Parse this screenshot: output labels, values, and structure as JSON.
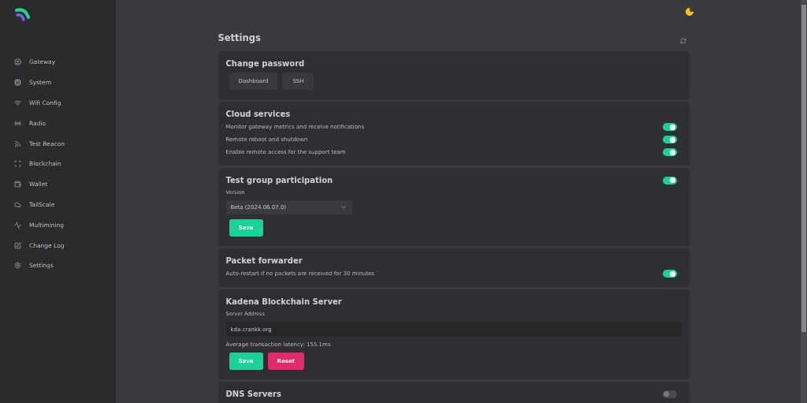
{
  "sidebar": {
    "items": [
      {
        "label": "Gateway"
      },
      {
        "label": "System"
      },
      {
        "label": "Wifi Config"
      },
      {
        "label": "Radio"
      },
      {
        "label": "Test Beacon"
      },
      {
        "label": "Blockchain"
      },
      {
        "label": "Wallet"
      },
      {
        "label": "TailScale"
      },
      {
        "label": "Multimining"
      },
      {
        "label": "Change Log"
      },
      {
        "label": "Settings"
      }
    ]
  },
  "page": {
    "title": "Settings"
  },
  "sections": [
    {
      "title": "Change password",
      "blocks": [
        {
          "kind": "buttons",
          "buttons": [
            {
              "label": "Dashboard",
              "kind": "plain"
            },
            {
              "label": "SSH",
              "kind": "plain"
            }
          ]
        }
      ]
    },
    {
      "title": "Cloud services",
      "blocks": [
        {
          "kind": "toggle",
          "label": "Monitor gateway metrics and receive notifications",
          "on": true
        },
        {
          "kind": "toggle",
          "label": "Remote reboot and shutdown",
          "on": true
        },
        {
          "kind": "toggle",
          "label": "Enable remote access for the support team",
          "on": true
        }
      ]
    },
    {
      "title": "Test group participation",
      "header_toggle": {
        "on": true
      },
      "blocks": [
        {
          "kind": "select",
          "label": "Version",
          "value": "Beta (2024.06.07.0)"
        },
        {
          "kind": "buttons",
          "buttons": [
            {
              "label": "Save",
              "kind": "primary"
            }
          ]
        }
      ]
    },
    {
      "title": "Packet forwarder",
      "blocks": [
        {
          "kind": "toggle",
          "label": "Auto-restart if no packets are received for 30 minutes",
          "on": true
        }
      ]
    },
    {
      "title": "Kadena Blockchain Server",
      "blocks": [
        {
          "kind": "input",
          "label": "Server Address",
          "value": "kda.crankk.org"
        },
        {
          "kind": "note",
          "text": "Average transaction latency: 155.1ms"
        },
        {
          "kind": "buttons",
          "buttons": [
            {
              "label": "Save",
              "kind": "primary"
            },
            {
              "label": "Reset",
              "kind": "danger"
            }
          ]
        }
      ]
    },
    {
      "title": "DNS Servers",
      "header_toggle": {
        "on": false
      }
    }
  ]
}
